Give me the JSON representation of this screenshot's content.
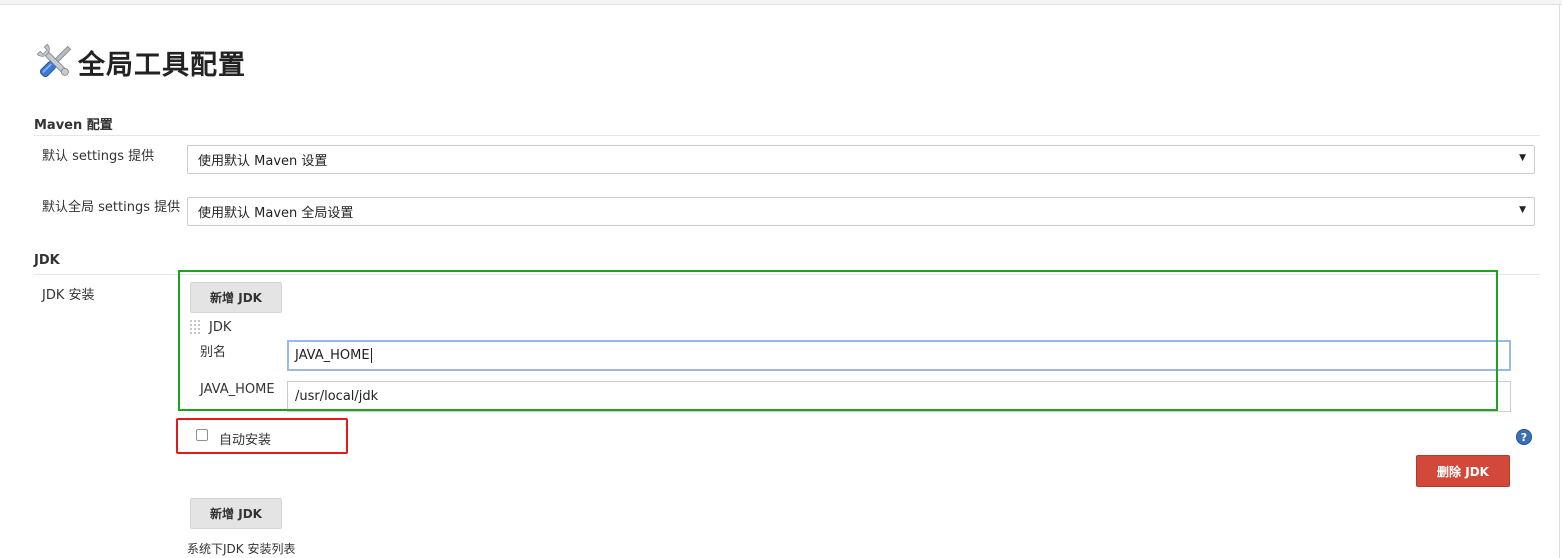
{
  "page": {
    "title": "全局工具配置",
    "icon": "tools-icon"
  },
  "maven": {
    "section_title": "Maven 配置",
    "settings_label": "默认 settings 提供",
    "settings_value": "使用默认 Maven 设置",
    "global_settings_label": "默认全局 settings 提供",
    "global_settings_value": "使用默认 Maven 全局设置",
    "dropdown_arrow": "▼"
  },
  "jdk": {
    "section_title": "JDK",
    "installations_label": "JDK 安装",
    "add_button_label": "新增 JDK",
    "entry_title": "JDK",
    "alias_label": "别名",
    "alias_value": "JAVA_HOME",
    "java_home_label": "JAVA_HOME",
    "java_home_value": "/usr/local/jdk",
    "auto_install_label": "自动安装",
    "auto_install_checked": false,
    "help_symbol": "?",
    "delete_button_label": "删除 JDK",
    "add_button_bottom_label": "新增 JDK",
    "list_hint": "系统下JDK 安装列表"
  },
  "colors": {
    "highlight_green": "#1ea31e",
    "highlight_red": "#e31a1a",
    "delete_button": "#d24939",
    "help_icon": "#3a6fb3",
    "focus_border": "#9bb8e8"
  }
}
